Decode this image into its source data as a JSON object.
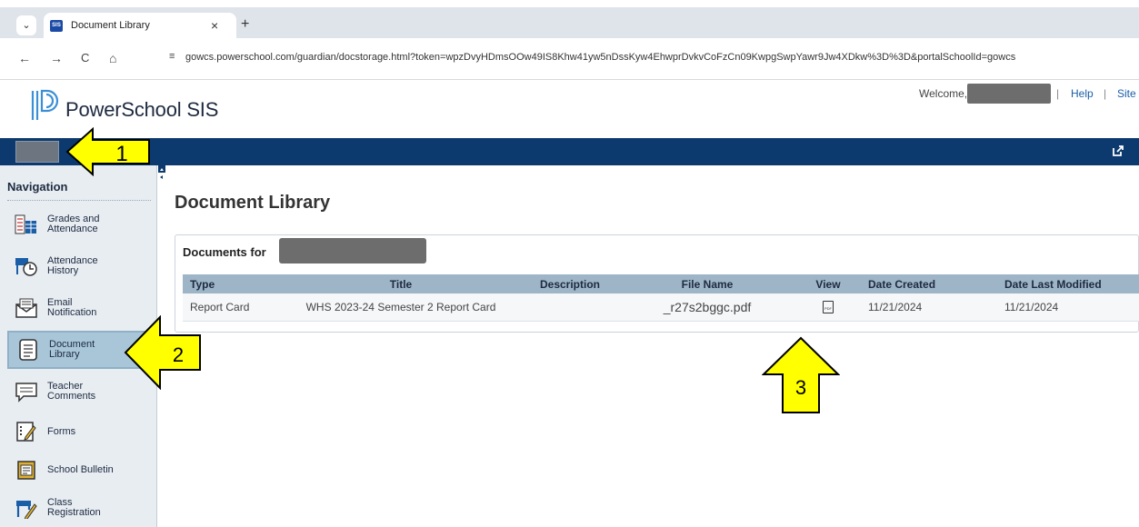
{
  "browser": {
    "tab_title": "Document Library",
    "tab_favicon_text": "SIS",
    "tab_close": "×",
    "new_tab": "+",
    "url": "gowcs.powerschool.com/guardian/docstorage.html?token=wpzDvyHDmsOOw49IS8Khw41yw5nDssKyw4EhwprDvkvCoFzCn09KwpgSwpYawr9Jw4XDkw%3D%3D&portalSchoolId=gowcs",
    "back_icon": "←",
    "forward_icon": "→",
    "reload_icon": "C",
    "home_icon": "⌂"
  },
  "header": {
    "app_name": "PowerSchool SIS",
    "welcome_label": "Welcome,",
    "separator": "|",
    "help_label": "Help",
    "site_label": "Site",
    "accent_color": "#0c3a6e"
  },
  "sidebar": {
    "heading": "Navigation",
    "items": [
      {
        "label": "Grades and Attendance",
        "icon": "grades-icon",
        "active": false
      },
      {
        "label": "Attendance History",
        "icon": "attendance-history-icon",
        "active": false
      },
      {
        "label": "Email Notification",
        "icon": "email-icon",
        "active": false
      },
      {
        "label": "Document Library",
        "icon": "document-icon",
        "active": true
      },
      {
        "label": "Teacher Comments",
        "icon": "comments-icon",
        "active": false
      },
      {
        "label": "Forms",
        "icon": "forms-icon",
        "active": false
      },
      {
        "label": "School Bulletin",
        "icon": "bulletin-icon",
        "active": false
      },
      {
        "label": "Class Registration",
        "icon": "registration-icon",
        "active": false
      }
    ]
  },
  "main": {
    "page_title": "Document Library",
    "documents_for_label": "Documents for",
    "table": {
      "headers": [
        "Type",
        "Title",
        "Description",
        "File Name",
        "View",
        "Date Created",
        "Date Last Modified"
      ],
      "rows": [
        {
          "type": "Report Card",
          "title": "WHS 2023-24 Semester 2 Report Card",
          "description": "",
          "file_name": "_r27s2bggc.pdf",
          "view_icon": "pdf-icon",
          "view_text": "PDF",
          "date_created": "11/21/2024",
          "date_modified": "11/21/2024"
        }
      ]
    }
  },
  "annotations": [
    {
      "label": "1",
      "color": "#ffff00"
    },
    {
      "label": "2",
      "color": "#ffff00"
    },
    {
      "label": "3",
      "color": "#ffff00"
    }
  ]
}
